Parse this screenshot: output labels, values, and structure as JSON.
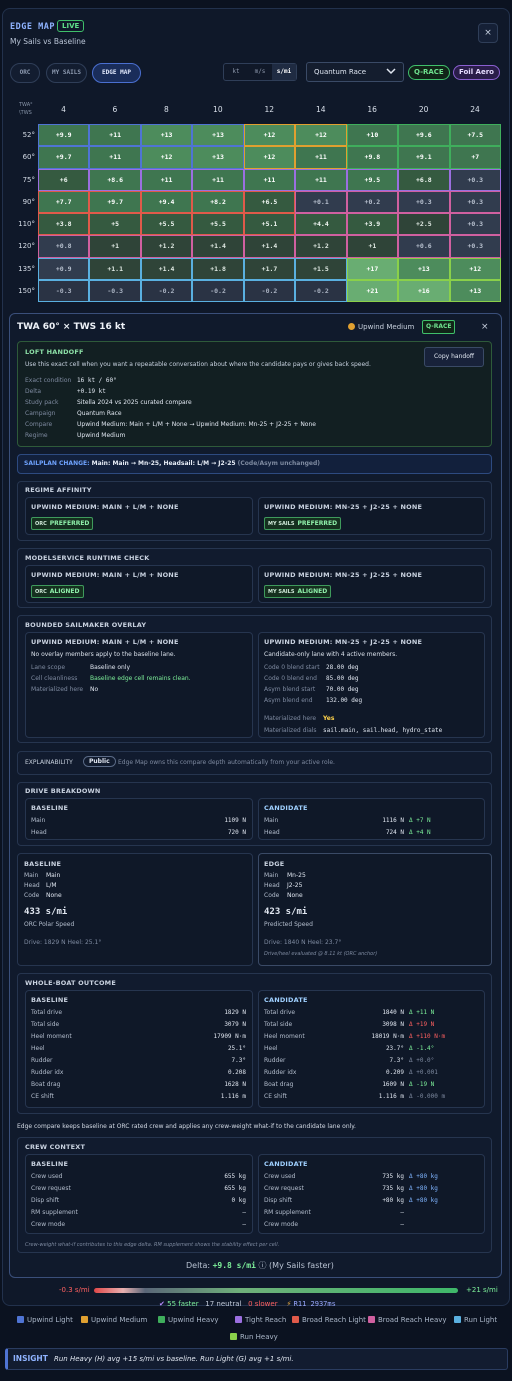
{
  "header": {
    "title": "EDGE MAP",
    "live": "LIVE",
    "subtitle": "My Sails vs Baseline",
    "close": "×"
  },
  "toolbar": {
    "pills": [
      "ORC",
      "MY SAILS",
      "EDGE MAP"
    ],
    "units": [
      "kt",
      "m/s",
      "s/mi"
    ],
    "campaign": "Quantum Race",
    "tag_qrace": "Q-RACE",
    "tag_foil": "Foil Aero"
  },
  "colors": {
    "upwind_light": "#4f74d4",
    "upwind_medium": "#e0a030",
    "upwind_heavy": "#3fae5c",
    "tight_reach": "#9b6fe0",
    "broad_reach_light": "#e05a4a",
    "broad_reach_heavy": "#d060a0",
    "run_light": "#5ab0e0",
    "run_heavy": "#8ad04a"
  },
  "grid": {
    "axis_label": "TWA°\\TWS",
    "tws": [
      "4",
      "6",
      "8",
      "10",
      "12",
      "14",
      "16",
      "20",
      "24"
    ],
    "twa": [
      "52°",
      "60°",
      "75°",
      "90°",
      "110°",
      "120°",
      "135°",
      "150°"
    ],
    "rows": [
      [
        "+9.9",
        "+11",
        "+13",
        "+13",
        "+12",
        "+12",
        "+10",
        "+9.6",
        "+7.5"
      ],
      [
        "+9.7",
        "+11",
        "+12",
        "+13",
        "+12",
        "+11",
        "+9.8",
        "+9.1",
        "+7"
      ],
      [
        "+6",
        "+8.6",
        "+11",
        "+11",
        "+11",
        "+11",
        "+9.5",
        "+6.8",
        "+0.3"
      ],
      [
        "+7.7",
        "+9.7",
        "+9.4",
        "+8.2",
        "+6.5",
        "+0.1",
        "+0.2",
        "+0.3",
        "+0.3"
      ],
      [
        "+3.8",
        "+5",
        "+5.5",
        "+5.5",
        "+5.1",
        "+4.4",
        "+3.9",
        "+2.5",
        "+0.3"
      ],
      [
        "+0.8",
        "+1",
        "+1.2",
        "+1.4",
        "+1.4",
        "+1.2",
        "+1",
        "+0.6",
        "+0.3"
      ],
      [
        "+0.9",
        "+1.1",
        "+1.4",
        "+1.8",
        "+1.7",
        "+1.5",
        "+17",
        "+13",
        "+12"
      ],
      [
        "-0.3",
        "-0.3",
        "-0.2",
        "-0.2",
        "-0.2",
        "-0.2",
        "+21",
        "+16",
        "+13"
      ]
    ]
  },
  "detail": {
    "title": "TWA 60° × TWS 16 kt",
    "regime_chip": "Upwind Medium",
    "qrace": "Q-RACE",
    "close": "×",
    "loft": {
      "heading": "LOFT HANDOFF",
      "desc": "Use this exact cell when you want a repeatable conversation about where the candidate pays or gives back speed.",
      "copy": "Copy handoff",
      "rows": [
        [
          "Exact condition",
          "16 kt / 60°"
        ],
        [
          "Delta",
          "+0.19 kt"
        ],
        [
          "Study pack",
          "Sitella 2024 vs 2025 curated compare"
        ],
        [
          "Campaign",
          "Quantum Race"
        ],
        [
          "Compare",
          "Upwind Medium: Main + L/M + None → Upwind Medium: Mn-25 + J2-25 + None"
        ],
        [
          "Regime",
          "Upwind Medium"
        ]
      ]
    },
    "sailplan": {
      "label": "SAILPLAN CHANGE:",
      "text": "Main: Main → Mn-25, Headsail: L/M → J2-25",
      "tail": "(Code/Asym unchanged)"
    },
    "regime": {
      "heading": "REGIME AFFINITY",
      "left": "UPWIND MEDIUM: MAIN + L/M + NONE",
      "right": "UPWIND MEDIUM: MN-25 + J2-25 + NONE",
      "left_badge_pre": "ORC",
      "left_badge": "PREFERRED",
      "right_badge_pre": "MY SAILS",
      "right_badge": "PREFERRED"
    },
    "modelservice": {
      "heading": "MODELSERVICE RUNTIME CHECK",
      "left": "UPWIND MEDIUM: MAIN + L/M + NONE",
      "right": "UPWIND MEDIUM: MN-25 + J2-25 + NONE",
      "left_badge_pre": "ORC",
      "left_badge": "ALIGNED",
      "right_badge_pre": "MY SAILS",
      "right_badge": "ALIGNED"
    },
    "overlay": {
      "heading": "BOUNDED SAILMAKER OVERLAY",
      "left": "UPWIND MEDIUM: MAIN + L/M + NONE",
      "left_note": "No overlay members apply to the baseline lane.",
      "left_rows": [
        [
          "Lane scope",
          "Baseline only"
        ],
        [
          "Cell cleanliness",
          "Baseline edge cell remains clean."
        ],
        [
          "Materialized here",
          "No"
        ]
      ],
      "right": "UPWIND MEDIUM: MN-25 + J2-25 + NONE",
      "right_note": "Candidate-only lane with 4 active members.",
      "right_rows": [
        [
          "Code 0 blend start",
          "28.00 deg"
        ],
        [
          "Code 0 blend end",
          "85.00 deg"
        ],
        [
          "Asym blend start",
          "70.00 deg"
        ],
        [
          "Asym blend end",
          "132.00 deg"
        ]
      ],
      "mat_here_label": "Materialized here",
      "mat_here": "Yes",
      "mat_dials_label": "Materialized dials",
      "mat_dials": "sail.main, sail.head, hydro_state"
    },
    "explain": {
      "label": "EXPLAINABILITY",
      "chip": "Public",
      "text": "Edge Map owns this compare depth automatically from your active role."
    },
    "drive": {
      "heading": "DRIVE BREAKDOWN",
      "base": "BASELINE",
      "cand": "CANDIDATE",
      "base_rows": [
        [
          "Main",
          "1109 N"
        ],
        [
          "Head",
          "720 N"
        ]
      ],
      "cand_rows": [
        [
          "Main",
          "1116 N",
          "Δ +7 N"
        ],
        [
          "Head",
          "724 N",
          "Δ +4 N"
        ]
      ]
    },
    "speed": {
      "base": "BASELINE",
      "edge": "EDGE",
      "base_rows": [
        [
          "Main",
          "Main"
        ],
        [
          "Head",
          "L/M"
        ],
        [
          "Code",
          "None"
        ]
      ],
      "base_speed": "433 s/mi",
      "base_caption": "ORC Polar Speed",
      "base_foot": "Drive: 1829 N  Heel: 25.1°",
      "edge_rows": [
        [
          "Main",
          "Mn-25"
        ],
        [
          "Head",
          "J2-25"
        ],
        [
          "Code",
          "None"
        ]
      ],
      "edge_speed": "423 s/mi",
      "edge_caption": "Predicted Speed",
      "edge_foot": "Drive: 1840 N  Heel: 23.7°",
      "edge_note": "Drive/heel evaluated @ 8.11 kt (ORC anchor)"
    },
    "outcome": {
      "heading": "WHOLE-BOAT OUTCOME",
      "base": "BASELINE",
      "cand": "CANDIDATE",
      "base_rows": [
        [
          "Total drive",
          "1829 N"
        ],
        [
          "Total side",
          "3079 N"
        ],
        [
          "Heel moment",
          "17909 N·m"
        ],
        [
          "Heel",
          "25.1°"
        ],
        [
          "Rudder",
          "7.3°"
        ],
        [
          "Rudder idx",
          "0.208"
        ],
        [
          "Boat drag",
          "1628 N"
        ],
        [
          "CE shift",
          "1.116 m"
        ]
      ],
      "cand_rows": [
        [
          "Total drive",
          "1840 N",
          "Δ +11 N",
          "pos"
        ],
        [
          "Total side",
          "3098 N",
          "Δ +19 N",
          "neg"
        ],
        [
          "Heel moment",
          "18019 N·m",
          "Δ +110 N·m",
          "neg"
        ],
        [
          "Heel",
          "23.7°",
          "Δ -1.4°",
          "pos"
        ],
        [
          "Rudder",
          "7.3°",
          "Δ +0.0°",
          "neu"
        ],
        [
          "Rudder idx",
          "0.209",
          "Δ +0.001",
          "neu"
        ],
        [
          "Boat drag",
          "1609 N",
          "Δ -19 N",
          "pos"
        ],
        [
          "CE shift",
          "1.116 m",
          "Δ -0.000 m",
          "neu"
        ]
      ]
    },
    "crew_note": "Edge compare keeps baseline at ORC rated crew and applies any crew-weight what-if to the candidate lane only.",
    "crew": {
      "heading": "CREW CONTEXT",
      "base": "BASELINE",
      "cand": "CANDIDATE",
      "base_rows": [
        [
          "Crew used",
          "655 kg"
        ],
        [
          "Crew request",
          "655 kg"
        ],
        [
          "Disp shift",
          "0 kg"
        ],
        [
          "RM supplement",
          "—"
        ],
        [
          "Crew mode",
          "—"
        ]
      ],
      "cand_rows": [
        [
          "Crew used",
          "735 kg",
          "Δ +80 kg"
        ],
        [
          "Crew request",
          "735 kg",
          "Δ +80 kg"
        ],
        [
          "Disp shift",
          "+80 kg",
          "Δ +80 kg"
        ],
        [
          "RM supplement",
          "—",
          ""
        ],
        [
          "Crew mode",
          "—",
          ""
        ]
      ],
      "foot": "Crew-weight what-if contributes to this edge delta. RM supplement shows the stability effect per cell."
    },
    "delta": {
      "label": "Delta:",
      "value": "+9.8 s/mi",
      "note": "(My Sails faster)"
    }
  },
  "scale": {
    "min": "-0.3 s/mi",
    "max": "+21 s/mi"
  },
  "counts": {
    "faster": "55 faster",
    "neutral": "17 neutral",
    "slower": "0 slower",
    "timing": "R11 2937ms"
  },
  "legend": [
    "Upwind Light",
    "Upwind Medium",
    "Upwind Heavy",
    "Tight Reach",
    "Broad Reach Light",
    "Broad Reach Heavy",
    "Run Light",
    "Run Heavy"
  ],
  "insight": {
    "label": "INSIGHT",
    "text": "Run Heavy (H) avg +15 s/mi vs baseline. Run Light (G) avg +1 s/mi."
  }
}
